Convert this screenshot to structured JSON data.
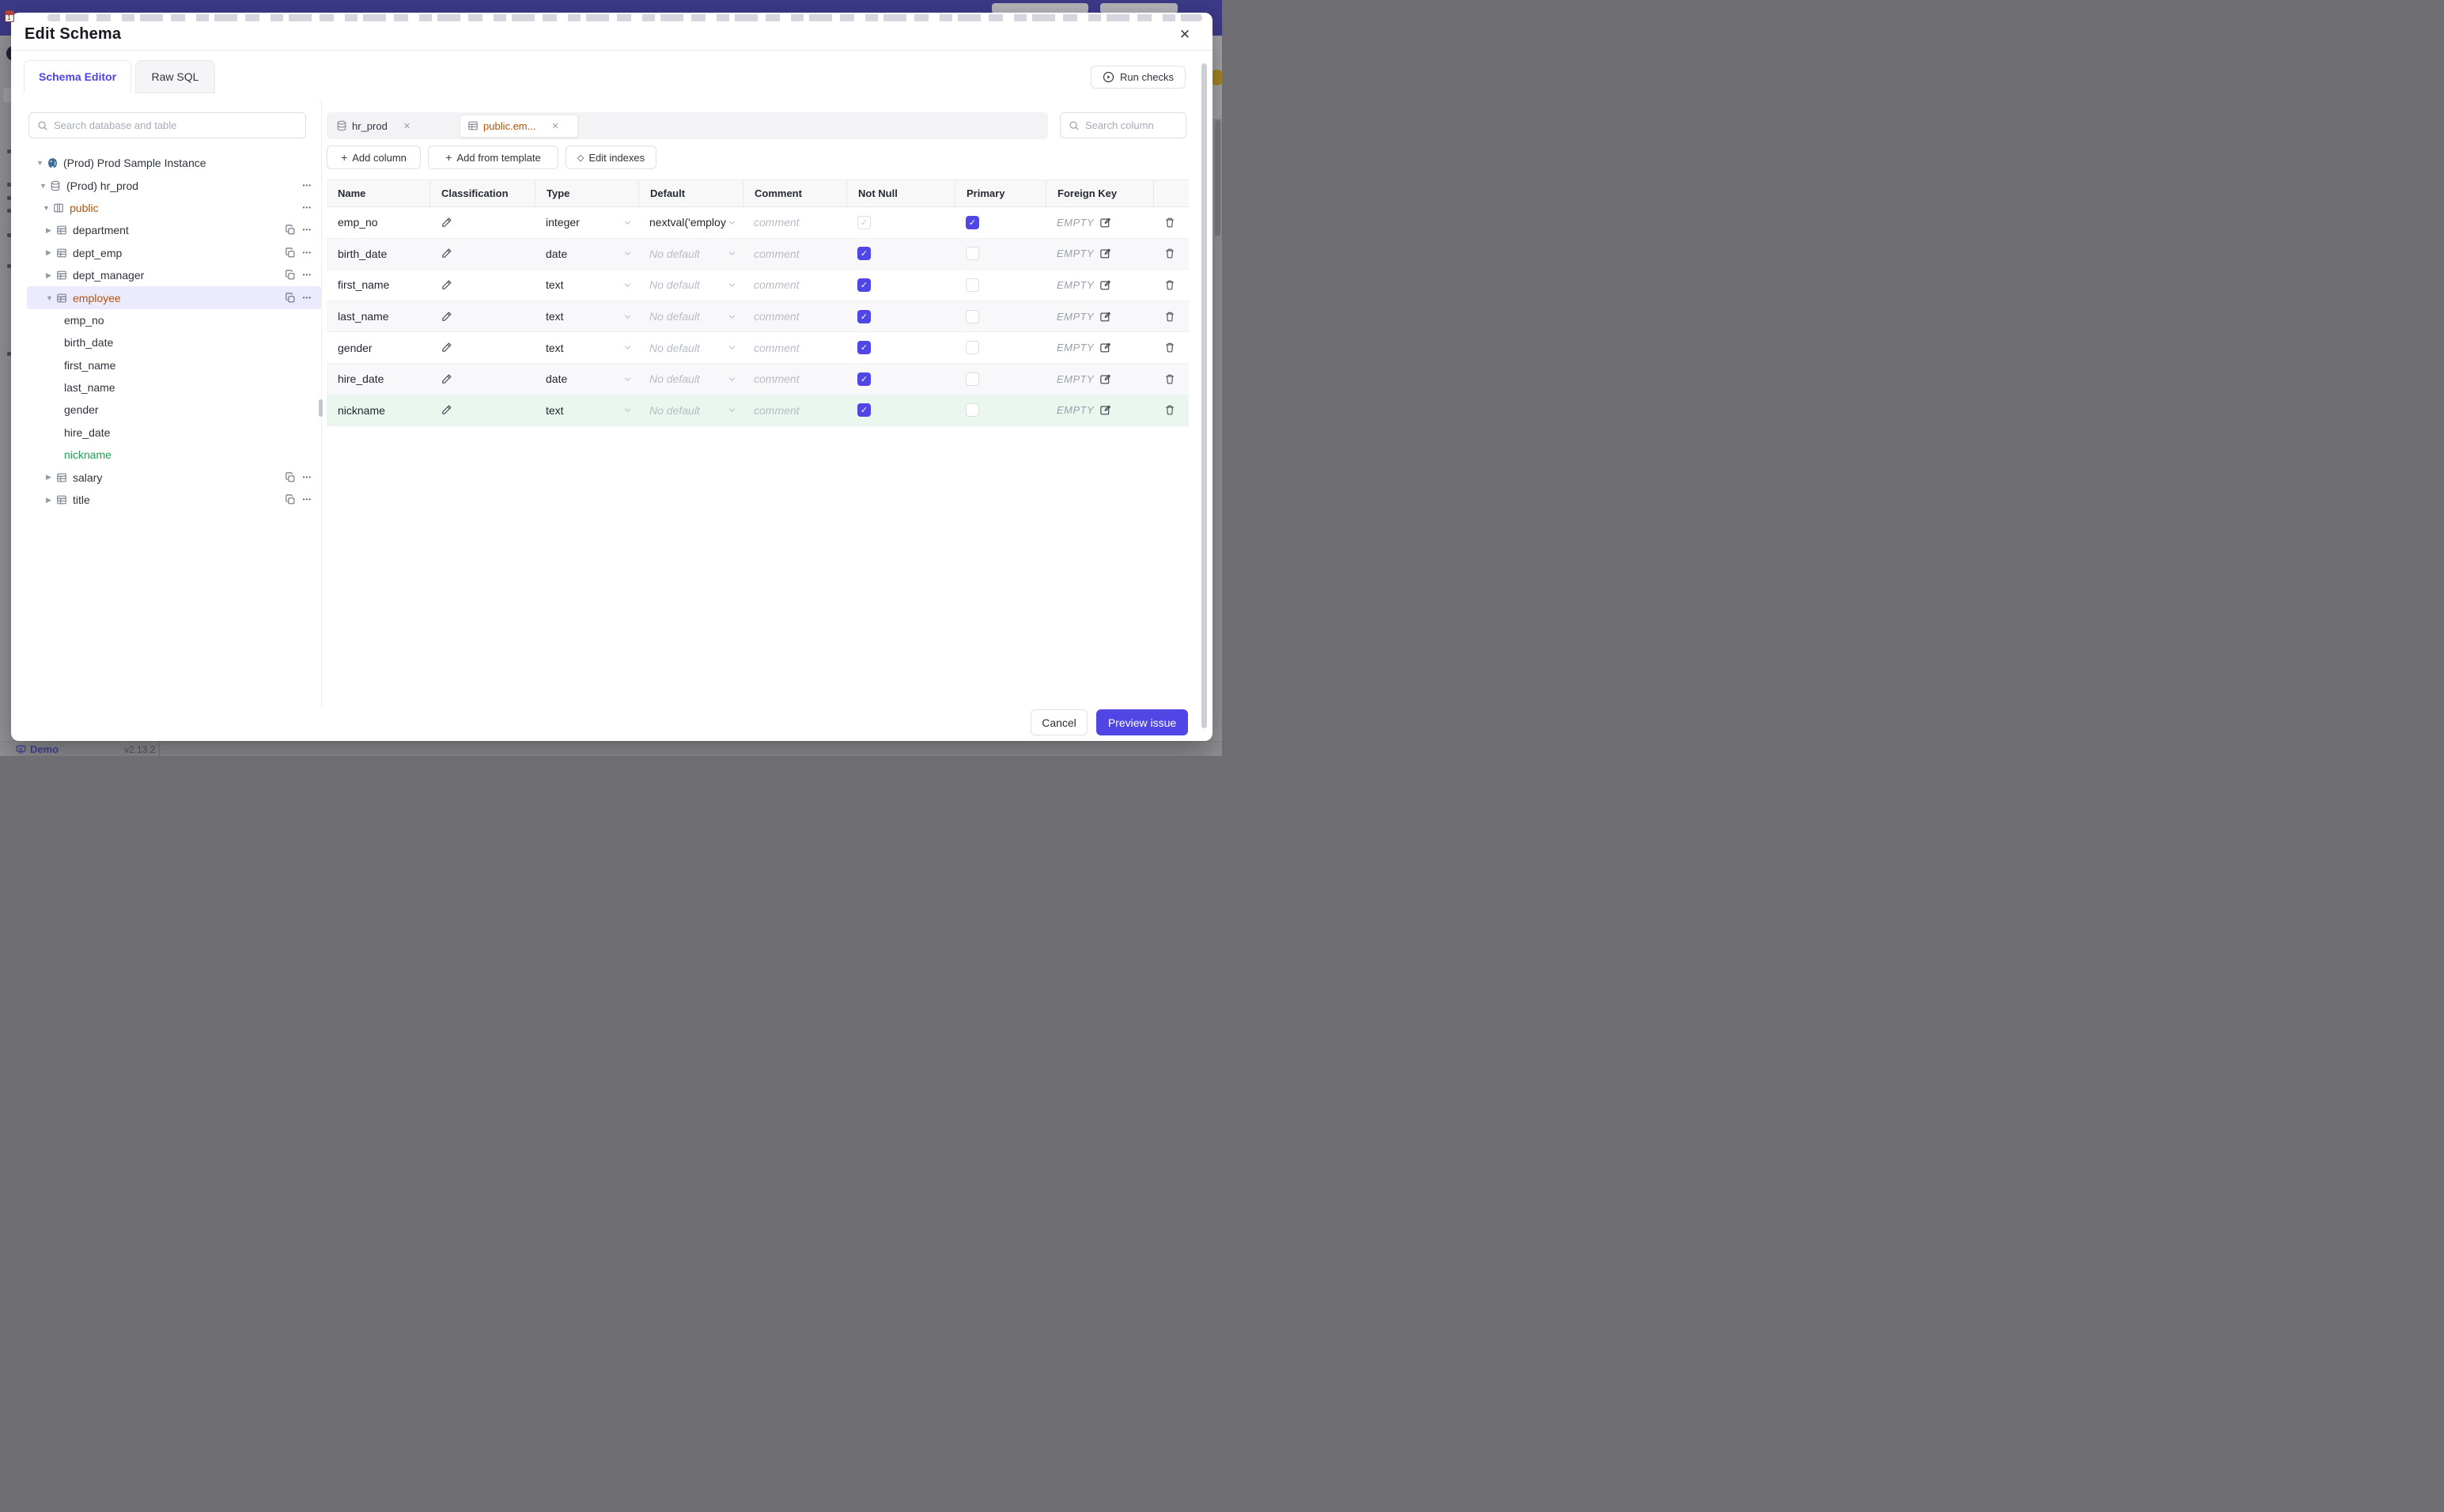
{
  "app_background": {
    "statusbar": {
      "demo_label": "Demo",
      "version": "v2.13.2"
    }
  },
  "modal": {
    "title": "Edit Schema",
    "tabs": [
      {
        "label": "Schema Editor",
        "active": true
      },
      {
        "label": "Raw SQL",
        "active": false
      }
    ],
    "run_checks": {
      "label": "Run checks",
      "icon": "play-circle-icon"
    },
    "sidebar": {
      "search_placeholder": "Search database and table",
      "tree": [
        {
          "label": "(Prod) Prod Sample Instance",
          "type": "instance",
          "caret": "down",
          "depth": 0,
          "actions": []
        },
        {
          "label": "(Prod) hr_prod",
          "type": "database",
          "caret": "down",
          "depth": 1,
          "actions": [
            "more"
          ]
        },
        {
          "label": "public",
          "type": "schema",
          "caret": "down",
          "depth": 2,
          "color": "amber",
          "actions": [
            "more"
          ]
        },
        {
          "label": "department",
          "type": "table",
          "caret": "right",
          "depth": 3,
          "actions": [
            "copy",
            "more"
          ]
        },
        {
          "label": "dept_emp",
          "type": "table",
          "caret": "right",
          "depth": 3,
          "actions": [
            "copy",
            "more"
          ]
        },
        {
          "label": "dept_manager",
          "type": "table",
          "caret": "right",
          "depth": 3,
          "actions": [
            "copy",
            "more"
          ]
        },
        {
          "label": "employee",
          "type": "table",
          "caret": "down",
          "depth": 3,
          "color": "amber",
          "selected": true,
          "actions": [
            "copy",
            "more"
          ]
        },
        {
          "label": "emp_no",
          "type": "column",
          "depth": 4,
          "actions": []
        },
        {
          "label": "birth_date",
          "type": "column",
          "depth": 4,
          "actions": []
        },
        {
          "label": "first_name",
          "type": "column",
          "depth": 4,
          "actions": []
        },
        {
          "label": "last_name",
          "type": "column",
          "depth": 4,
          "actions": []
        },
        {
          "label": "gender",
          "type": "column",
          "depth": 4,
          "actions": []
        },
        {
          "label": "hire_date",
          "type": "column",
          "depth": 4,
          "actions": []
        },
        {
          "label": "nickname",
          "type": "column",
          "depth": 4,
          "color": "green",
          "actions": []
        },
        {
          "label": "salary",
          "type": "table",
          "caret": "right",
          "depth": 3,
          "actions": [
            "copy",
            "more"
          ]
        },
        {
          "label": "title",
          "type": "table",
          "caret": "right",
          "depth": 3,
          "actions": [
            "copy",
            "more"
          ]
        }
      ]
    },
    "editor": {
      "tabs": [
        {
          "label": "hr_prod",
          "icon": "database-icon",
          "active": false
        },
        {
          "label": "public.em...",
          "icon": "table-icon",
          "active": true
        }
      ],
      "column_search_placeholder": "Search column",
      "toolbar": [
        {
          "label": "Add column",
          "icon": "plus"
        },
        {
          "label": "Add from template",
          "icon": "plus"
        },
        {
          "label": "Edit indexes",
          "icon": "diamond"
        }
      ],
      "table": {
        "headers": [
          "Name",
          "Classification",
          "Type",
          "Default",
          "Comment",
          "Not Null",
          "Primary",
          "Foreign Key"
        ],
        "comment_placeholder": "comment",
        "foreign_key_value": "EMPTY",
        "rows": [
          {
            "name": "emp_no",
            "type": "integer",
            "default": "nextval('employ",
            "default_placeholder": false,
            "not_null": "checked-disabled",
            "primary": "checked",
            "highlight": "none"
          },
          {
            "name": "birth_date",
            "type": "date",
            "default": "No default",
            "default_placeholder": true,
            "not_null": "checked",
            "primary": "unchecked",
            "highlight": "none"
          },
          {
            "name": "first_name",
            "type": "text",
            "default": "No default",
            "default_placeholder": true,
            "not_null": "checked",
            "primary": "unchecked",
            "highlight": "none"
          },
          {
            "name": "last_name",
            "type": "text",
            "default": "No default",
            "default_placeholder": true,
            "not_null": "checked",
            "primary": "unchecked",
            "highlight": "none"
          },
          {
            "name": "gender",
            "type": "text",
            "default": "No default",
            "default_placeholder": true,
            "not_null": "checked",
            "primary": "unchecked",
            "highlight": "none"
          },
          {
            "name": "hire_date",
            "type": "date",
            "default": "No default",
            "default_placeholder": true,
            "not_null": "checked",
            "primary": "unchecked",
            "highlight": "none"
          },
          {
            "name": "nickname",
            "type": "text",
            "default": "No default",
            "default_placeholder": true,
            "not_null": "checked",
            "primary": "unchecked",
            "highlight": "green"
          }
        ]
      }
    },
    "footer": {
      "cancel_label": "Cancel",
      "submit_label": "Preview issue"
    },
    "colors": {
      "accent": "#4f46e5",
      "amber": "#b45309",
      "green": "#16a34a",
      "green_row": "#e9f7ee",
      "selected_row": "#eceafd",
      "topbar": "#3d3a88"
    }
  }
}
